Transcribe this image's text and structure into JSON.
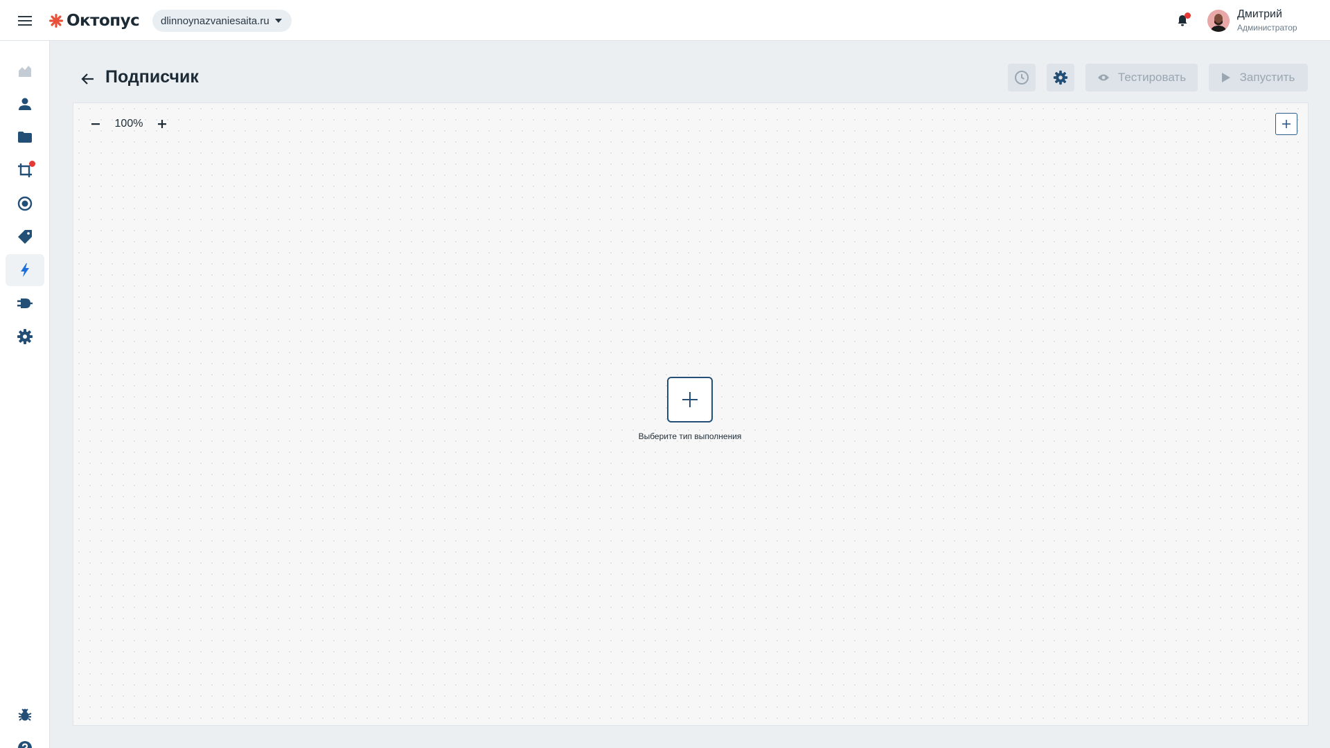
{
  "header": {
    "logo_text": "Октопус",
    "site": "dlinnoynazvaniesaita.ru",
    "user": {
      "name": "Дмитрий",
      "role": "Администратор"
    }
  },
  "sidebar": {
    "items": [
      {
        "icon": "chart-area-icon",
        "active": false
      },
      {
        "icon": "user-icon",
        "active": false
      },
      {
        "icon": "folder-icon",
        "active": false
      },
      {
        "icon": "crop-frame-icon",
        "active": false,
        "badge": true
      },
      {
        "icon": "target-icon",
        "active": false
      },
      {
        "icon": "tag-icon",
        "active": false
      },
      {
        "icon": "lightning-icon",
        "active": true
      },
      {
        "icon": "plug-icon",
        "active": false
      },
      {
        "icon": "gear-icon",
        "active": false
      }
    ],
    "bottom_items": [
      {
        "icon": "bug-icon"
      },
      {
        "icon": "help-icon"
      }
    ]
  },
  "page": {
    "title": "Подписчик",
    "test_label": "Тестировать",
    "run_label": "Запустить"
  },
  "canvas": {
    "zoom": "100%",
    "start_node_label": "Выберите тип выполнения"
  },
  "colors": {
    "accent": "#234e76",
    "brand": "#e8503a",
    "badge": "#e53935",
    "active_icon": "#1e6fd9"
  }
}
